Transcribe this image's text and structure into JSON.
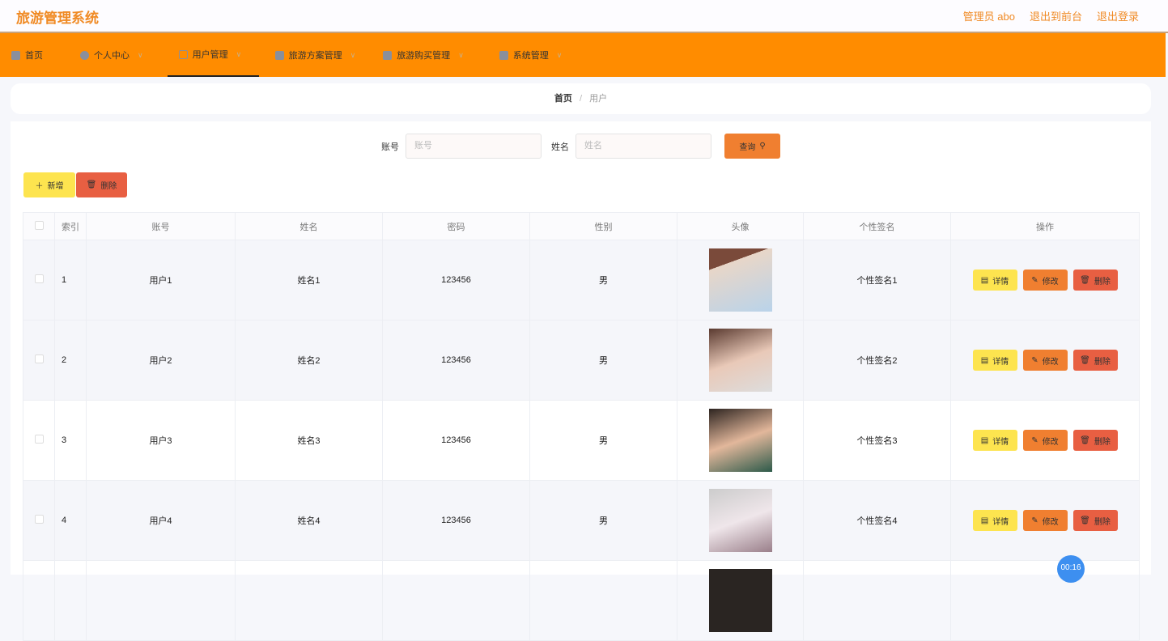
{
  "header": {
    "title": "旅游管理系统",
    "user": "管理员 abo",
    "front": "退出到前台",
    "logout": "退出登录"
  },
  "nav": [
    {
      "label": "首页"
    },
    {
      "label": "个人中心"
    },
    {
      "label": "用户管理"
    },
    {
      "label": "旅游方案管理"
    },
    {
      "label": "旅游购买管理"
    },
    {
      "label": "系统管理"
    }
  ],
  "breadcrumb": {
    "home": "首页",
    "sep": "/",
    "current": "用户"
  },
  "search": {
    "account_label": "账号",
    "account_placeholder": "账号",
    "name_label": "姓名",
    "name_placeholder": "姓名",
    "query": "查询"
  },
  "actions": {
    "add": "新增",
    "delete": "删除"
  },
  "table": {
    "headers": [
      "索引",
      "账号",
      "姓名",
      "密码",
      "性别",
      "头像",
      "个性签名",
      "操作"
    ],
    "rows": [
      {
        "index": "1",
        "account": "用户1",
        "name": "姓名1",
        "password": "123456",
        "gender": "男",
        "signature": "个性签名1"
      },
      {
        "index": "2",
        "account": "用户2",
        "name": "姓名2",
        "password": "123456",
        "gender": "男",
        "signature": "个性签名2"
      },
      {
        "index": "3",
        "account": "用户3",
        "name": "姓名3",
        "password": "123456",
        "gender": "男",
        "signature": "个性签名3"
      },
      {
        "index": "4",
        "account": "用户4",
        "name": "姓名4",
        "password": "123456",
        "gender": "男",
        "signature": "个性签名4"
      }
    ],
    "row_actions": {
      "detail": "详情",
      "edit": "修改",
      "delete": "删除"
    }
  },
  "timer": "00:16"
}
